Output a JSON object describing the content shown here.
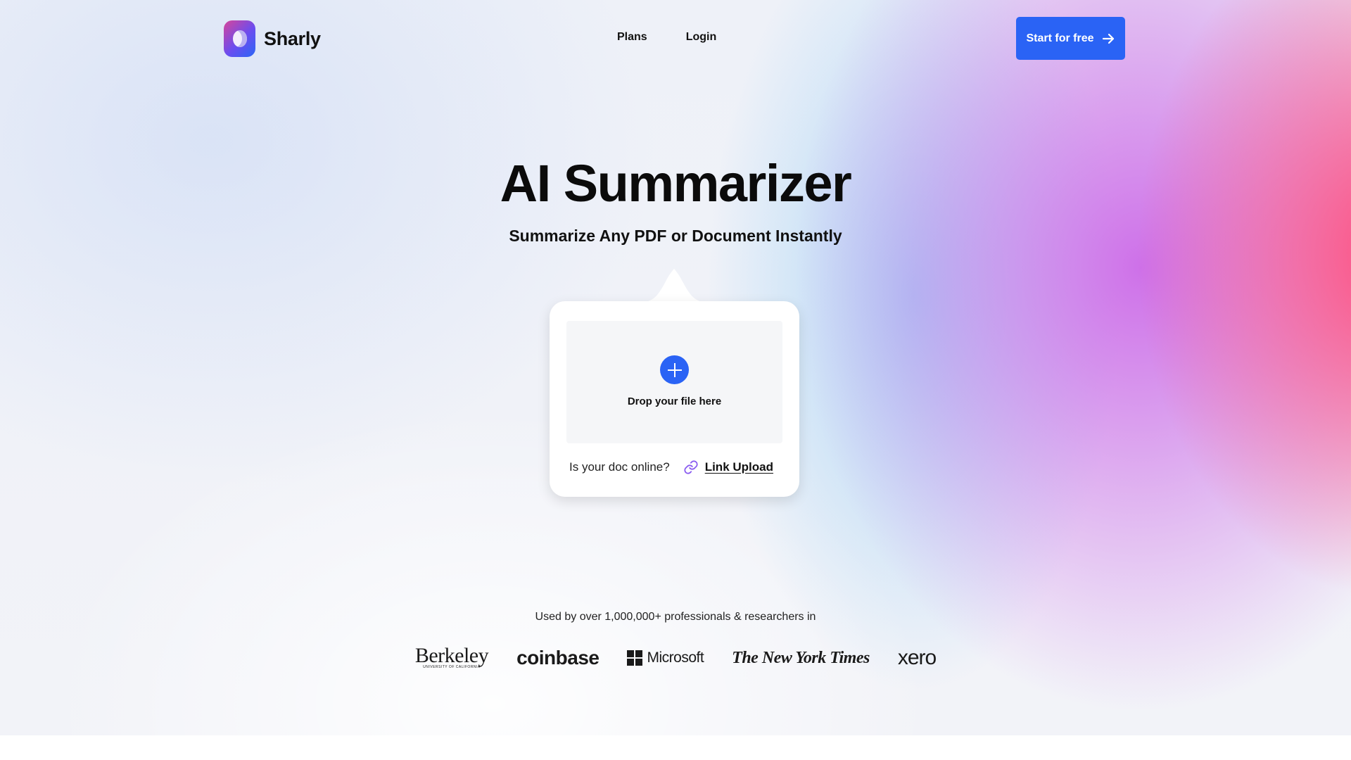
{
  "brand": {
    "name": "Sharly"
  },
  "nav": {
    "items": [
      {
        "label": "Plans"
      },
      {
        "label": "Login"
      }
    ]
  },
  "cta": {
    "label": "Start for free",
    "icon": "arrow-right-icon"
  },
  "hero": {
    "title": "AI Summarizer",
    "subtitle": "Summarize Any PDF or Document Instantly"
  },
  "upload": {
    "drop_label": "Drop your file here",
    "online_question": "Is your doc online?",
    "link_upload_label": "Link Upload"
  },
  "social_proof": {
    "text": "Used by over 1,000,000+ professionals & researchers in",
    "logos": [
      {
        "name": "Berkeley",
        "sub": "UNIVERSITY OF CALIFORNIA"
      },
      {
        "name": "coinbase"
      },
      {
        "name": "Microsoft"
      },
      {
        "name": "The New York Times"
      },
      {
        "name": "xero"
      }
    ]
  },
  "colors": {
    "accent": "#2a63f5",
    "link_icon": "#8a5cf0",
    "gradient_pink": "#ff4678",
    "gradient_purple": "#c85ae6",
    "gradient_blue": "#96cdf5"
  }
}
